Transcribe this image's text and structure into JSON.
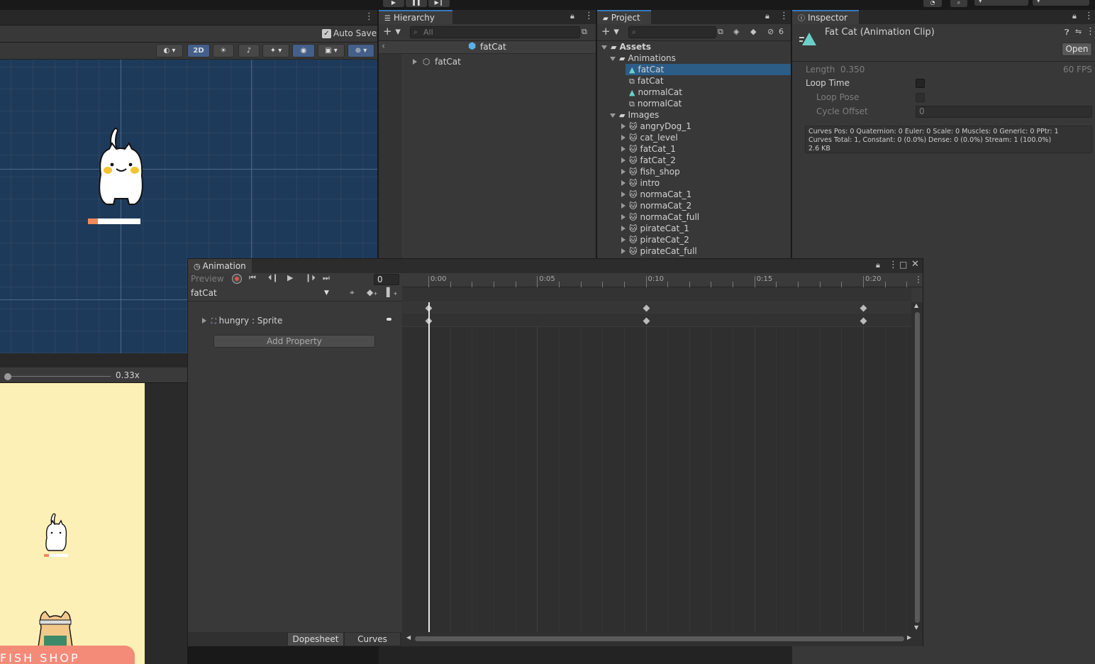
{
  "scene": {
    "auto_save_label": "Auto Save",
    "mode_2d_label": "2D",
    "game_scale_label": "0.33x",
    "shop_text": "FISH SHOP"
  },
  "hierarchy": {
    "tab_label": "Hierarchy",
    "search_placeholder": "All",
    "context_label": "fatCat",
    "items": [
      {
        "label": "fatCat"
      }
    ]
  },
  "project": {
    "tab_label": "Project",
    "hidden_count": "6",
    "tree": {
      "root": "Assets",
      "animations_folder": "Animations",
      "animations": [
        {
          "label": "fatCat",
          "kind": "clip",
          "selected": true
        },
        {
          "label": "fatCat",
          "kind": "controller"
        },
        {
          "label": "normalCat",
          "kind": "clip"
        },
        {
          "label": "normalCat",
          "kind": "controller"
        }
      ],
      "images_folder": "Images",
      "images": [
        {
          "label": "angryDog_1"
        },
        {
          "label": "cat_level"
        },
        {
          "label": "fatCat_1"
        },
        {
          "label": "fatCat_2"
        },
        {
          "label": "fish_shop"
        },
        {
          "label": "intro"
        },
        {
          "label": "normaCat_1"
        },
        {
          "label": "normaCat_2"
        },
        {
          "label": "normaCat_full"
        },
        {
          "label": "pirateCat_1"
        },
        {
          "label": "pirateCat_2"
        },
        {
          "label": "pirateCat_full"
        }
      ]
    }
  },
  "inspector": {
    "tab_label": "Inspector",
    "title": "Fat Cat (Animation Clip)",
    "open_label": "Open",
    "length_label": "Length",
    "length_value": "0.350",
    "fps_value": "60 FPS",
    "loop_time_label": "Loop Time",
    "loop_pose_label": "Loop Pose",
    "cycle_offset_label": "Cycle Offset",
    "cycle_offset_value": "0",
    "info_line1": "Curves Pos: 0 Quaternion: 0 Euler: 0 Scale: 0 Muscles: 0 Generic: 0 PPtr: 1",
    "info_line2": "Curves Total: 1, Constant: 0 (0.0%) Dense: 0 (0.0%) Stream: 1 (100.0%)",
    "info_line3": "2.6 KB"
  },
  "animation": {
    "tab_label": "Animation",
    "preview_label": "Preview",
    "frame_value": "0",
    "clip_name": "fatCat",
    "property_label": "hungry : Sprite",
    "add_property_label": "Add Property",
    "dopesheet_label": "Dopesheet",
    "curves_label": "Curves",
    "ruler_labels": [
      "0:00",
      "0:05",
      "0:10",
      "0:15",
      "0:20"
    ],
    "keyframe_times": [
      "0:00",
      "0:10",
      "0:20"
    ]
  }
}
